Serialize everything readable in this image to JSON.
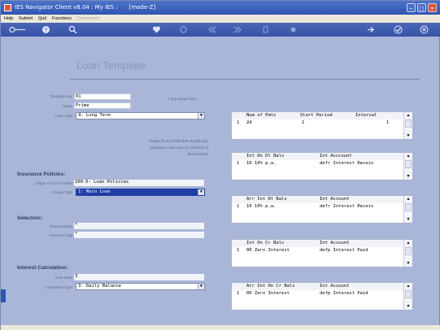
{
  "window": {
    "title": "IES Navigator Client v8.04 : My IES :",
    "mode": "[mode-Z]",
    "minimize_glyph": "–",
    "maximize_glyph": "□",
    "close_glyph": "×"
  },
  "menu": {
    "items": [
      "Help",
      "Submit",
      "Quit",
      "Functions",
      "Commands"
    ]
  },
  "toolbar": {
    "icons": [
      "key-icon",
      "info-icon",
      "search-icon",
      "heart-icon",
      "refresh-icon",
      "rewind-icon",
      "fast-forward-icon",
      "document-icon",
      "settings-icon",
      "forward-icon",
      "check-icon",
      "close-icon"
    ]
  },
  "page": {
    "title": "Loan Template"
  },
  "form": {
    "template_key_label": "Template Key",
    "template_key_value": "01",
    "unique_key_hint": "( any unique key )",
    "name_label": "Name",
    "name_value": "Prime",
    "loan_type_label": "Loan Type",
    "loan_type_value": "4: Long Term",
    "auto_fill_hint_1": "Please fill any fields that should auto",
    "auto_fill_hint_2": "populate a new Loan on selection of",
    "auto_fill_hint_3": "this template",
    "insurance_heading": "Insurance Policies:",
    "ledger_label": "Ledger Cr Ext Pol Retn",
    "ledger_value": "100-5- Loan Policies",
    "charge_type_label": "Charge Type",
    "charge_type_value": "1: Main Loan",
    "selection_heading": "Selection:",
    "responsibility_label": "Responsibility",
    "responsibility_value": "*",
    "selection_flag_label": "Selection Flag",
    "selection_flag_value": "*",
    "interest_heading": "Interest Calculation:",
    "scan_back_label": "Scan Back",
    "scan_back_value": "3",
    "calc_type_label": "Calculation Type",
    "calc_type_value": "3: Daily Balance"
  },
  "grids": [
    {
      "headers": [
        "Num of Pmts",
        "Start Period",
        "Interval"
      ],
      "row": [
        "1",
        "24",
        "1",
        "1"
      ]
    },
    {
      "headers": [
        "Int On Dt Bals",
        "Int Acccount"
      ],
      "row": [
        "1",
        "10 10% p.a.",
        "defr Interest Receiv"
      ]
    },
    {
      "headers": [
        "Arr Int Dt Bals",
        "Int Account"
      ],
      "row": [
        "1",
        "10 10% p.a.",
        "defr Interest Receiv"
      ]
    },
    {
      "headers": [
        "Int On Cr Bals",
        "Int Account"
      ],
      "row": [
        "1",
        "00 Zero Interest",
        "defp Interest Paid"
      ]
    },
    {
      "headers": [
        "Arr Int On Cr Bals",
        "Int Account"
      ],
      "row": [
        "1",
        "00 Zero Interest",
        "defp Interest Paid"
      ]
    }
  ],
  "scroll_glyphs": {
    "up": "▲",
    "down": "▼",
    "dropdown": "▼"
  }
}
